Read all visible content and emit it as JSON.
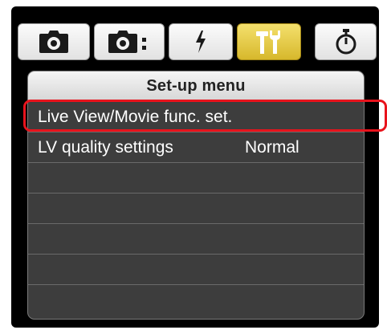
{
  "tabs": [
    {
      "icon": "camera-icon",
      "selected": false
    },
    {
      "icon": "camera-settings-icon",
      "selected": false
    },
    {
      "icon": "flash-icon",
      "selected": false
    },
    {
      "icon": "tools-icon",
      "selected": true
    },
    {
      "icon": "timer-icon",
      "selected": false
    }
  ],
  "menu": {
    "title": "Set-up menu",
    "items": [
      {
        "label": "Live View/Movie func. set.",
        "value": "",
        "highlighted": true
      },
      {
        "label": "LV quality settings",
        "value": "Normal",
        "highlighted": false
      }
    ]
  },
  "colors": {
    "highlight": "#e8131c",
    "selected_tab": "#e5c740",
    "panel_bg": "#3d3d3d"
  }
}
